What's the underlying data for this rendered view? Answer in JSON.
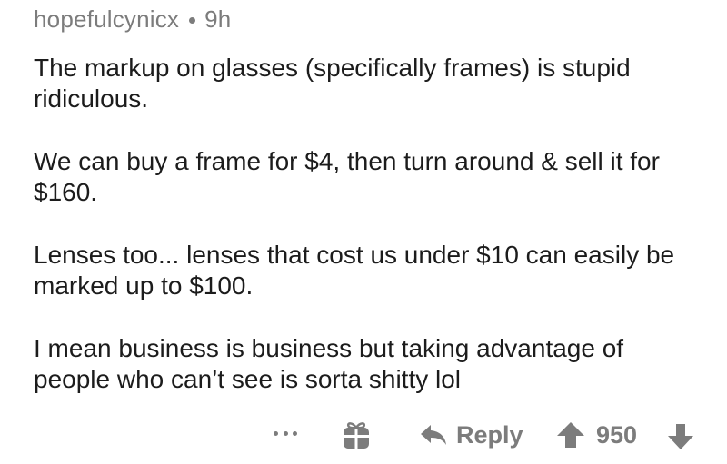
{
  "comment": {
    "username": "hopefulcynicx",
    "age": "9h",
    "paragraphs": [
      "The markup on glasses (specifically frames) is stupid ridiculous.",
      "We can buy a frame for $4, then turn around & sell it for $160.",
      "Lenses too... lenses that cost us under $10 can easily be marked up to $100.",
      "I mean business is business but taking advantage of people who can’t see is sorta shitty lol"
    ],
    "actions": {
      "more_icon": "more-options-icon",
      "award_icon": "gift-icon",
      "reply_icon": "reply-arrow-icon",
      "reply_label": "Reply",
      "upvote_icon": "upvote-arrow-icon",
      "score": "950",
      "downvote_icon": "downvote-arrow-icon"
    }
  },
  "colors": {
    "text": "#1c1c1c",
    "muted": "#7c7c7c",
    "background": "#ffffff"
  }
}
